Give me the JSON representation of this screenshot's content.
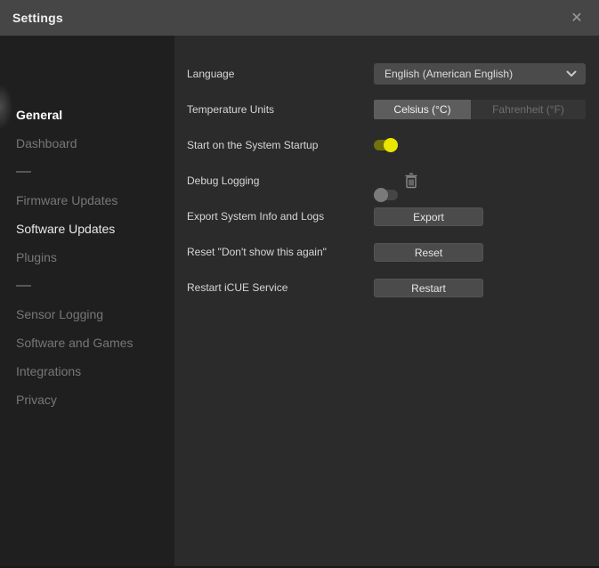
{
  "window": {
    "title": "Settings",
    "close_glyph": "✕"
  },
  "sidebar": {
    "items": [
      {
        "label": "General",
        "state": "active"
      },
      {
        "label": "Dashboard",
        "state": "normal"
      },
      {
        "type": "divider"
      },
      {
        "label": "Firmware Updates",
        "state": "normal"
      },
      {
        "label": "Software Updates",
        "state": "highlight"
      },
      {
        "label": "Plugins",
        "state": "normal"
      },
      {
        "type": "divider"
      },
      {
        "label": "Sensor Logging",
        "state": "normal"
      },
      {
        "label": "Software and Games",
        "state": "normal"
      },
      {
        "label": "Integrations",
        "state": "normal"
      },
      {
        "label": "Privacy",
        "state": "normal"
      }
    ]
  },
  "main": {
    "language": {
      "label": "Language",
      "value": "English (American English)"
    },
    "temperature": {
      "label": "Temperature Units",
      "options": [
        "Celsius (°C)",
        "Fahrenheit (°F)"
      ],
      "selected": "Celsius (°C)"
    },
    "startup": {
      "label": "Start on the System Startup",
      "state": "on"
    },
    "debug": {
      "label": "Debug Logging",
      "state": "off"
    },
    "export": {
      "label": "Export System Info and Logs",
      "button": "Export"
    },
    "reset": {
      "label": "Reset \"Don't show this again\"",
      "button": "Reset"
    },
    "restart": {
      "label": "Restart iCUE Service",
      "button": "Restart"
    }
  },
  "colors": {
    "titlebar": "#464646",
    "sidebar_bg": "#1f1f1f",
    "content_bg": "#2b2b2b",
    "accent_yellow": "#e9e600",
    "control_bg": "#4b4b4b",
    "seg_selected_bg": "#5d5d5d"
  }
}
